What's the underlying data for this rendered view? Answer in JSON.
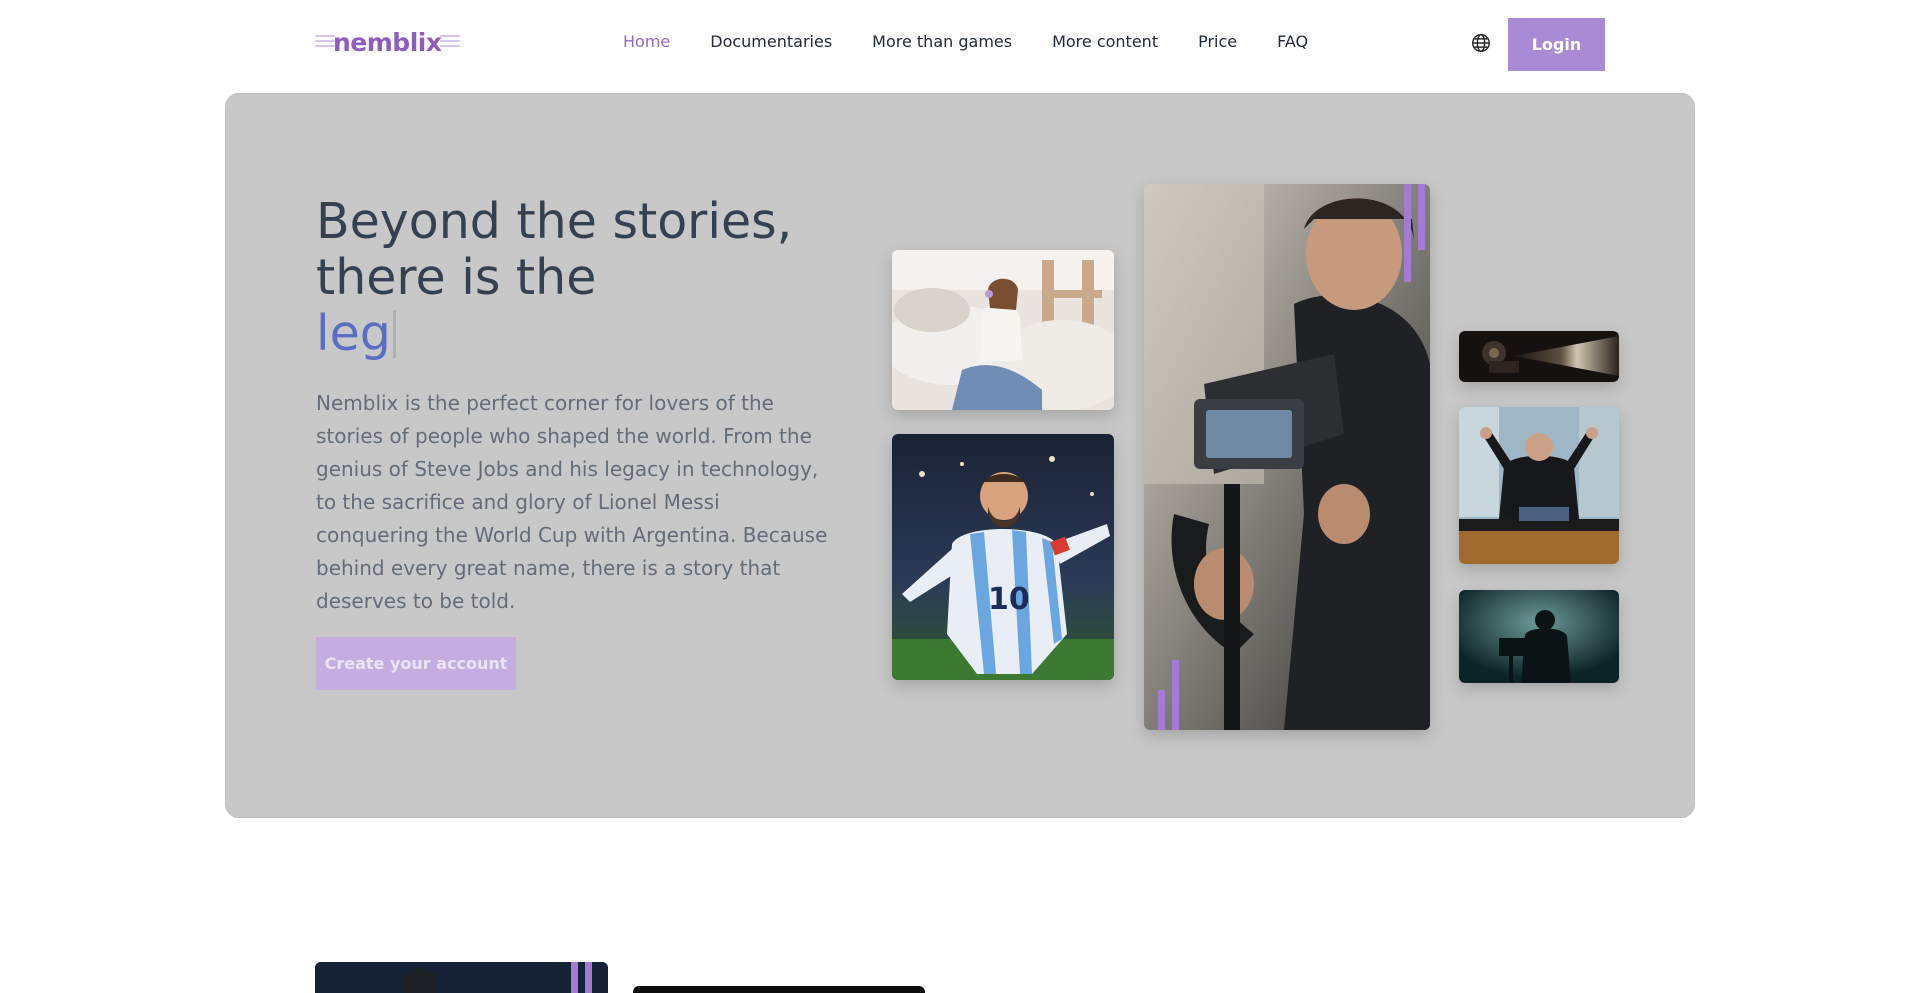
{
  "brand": {
    "logo_text": "nemblix",
    "accent_color": "#a98ad4",
    "headline_color": "#354050",
    "typed_color": "#5a6ec4"
  },
  "header": {
    "nav": [
      {
        "label": "Home",
        "active": true
      },
      {
        "label": "Documentaries",
        "active": false
      },
      {
        "label": "More than games",
        "active": false
      },
      {
        "label": "More content",
        "active": false
      },
      {
        "label": "Price",
        "active": false
      },
      {
        "label": "FAQ",
        "active": false
      }
    ],
    "language_icon": "globe-icon",
    "login_label": "Login"
  },
  "hero": {
    "title_line1": "Beyond the stories,",
    "title_line2": "there is the",
    "title_typed": "leg",
    "description": "Nemblix is the perfect corner for lovers of the stories of people who shaped the world. From the genius of Steve Jobs and his legacy in technology, to the sacrifice and glory of Lionel Messi conquering the World Cup with Argentina. Because behind every great name, there is a story that deserves to be told.",
    "cta_label": "Create your account"
  },
  "gallery": [
    {
      "name": "woman-reading-photo"
    },
    {
      "name": "soccer-player-celebrating-photo"
    },
    {
      "name": "cameraman-photo"
    },
    {
      "name": "film-projector-photo"
    },
    {
      "name": "presenter-on-stage-photo"
    },
    {
      "name": "silhouette-filmmaker-photo"
    }
  ]
}
